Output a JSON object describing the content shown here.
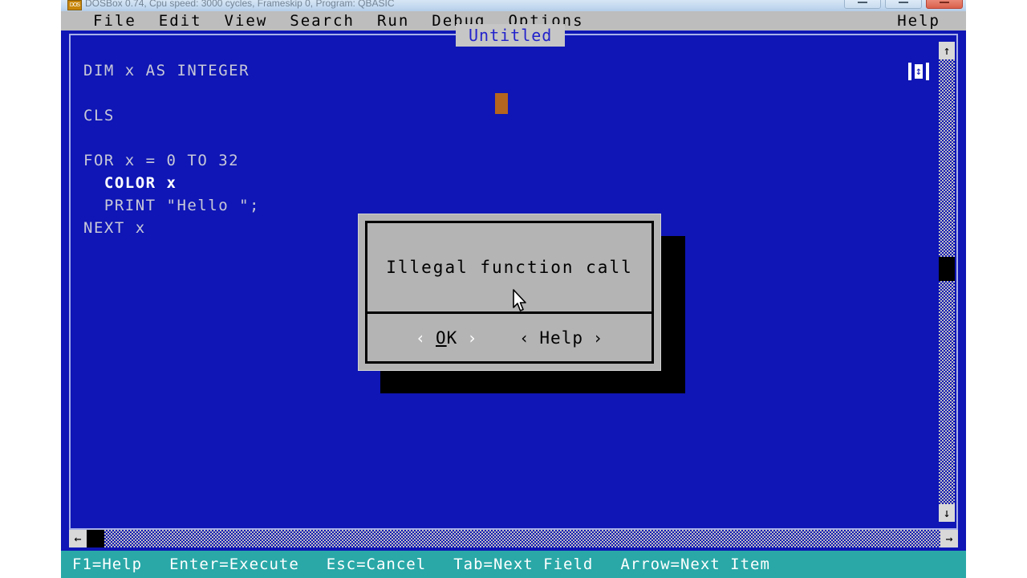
{
  "host_window": {
    "title": "DOSBox 0.74, Cpu speed: 3000 cycles, Frameskip 0, Program: QBASIC",
    "icon_label": "DOS",
    "buttons": [
      {
        "name": "minimize",
        "glyph": "_"
      },
      {
        "name": "maximize",
        "glyph": "□"
      },
      {
        "name": "close",
        "glyph": "×"
      }
    ]
  },
  "menubar": {
    "items": [
      {
        "label": "File"
      },
      {
        "label": "Edit"
      },
      {
        "label": "View"
      },
      {
        "label": "Search"
      },
      {
        "label": "Run"
      },
      {
        "label": "Debug"
      },
      {
        "label": "Options"
      }
    ],
    "help_label": "Help"
  },
  "editor": {
    "document_title": "Untitled",
    "code_lines": [
      {
        "text": "DIM x AS INTEGER",
        "highlight": false
      },
      {
        "text": "",
        "highlight": false
      },
      {
        "text": "CLS",
        "highlight": false
      },
      {
        "text": "",
        "highlight": false
      },
      {
        "text": "FOR x = 0 TO 32",
        "highlight": false
      },
      {
        "text": "  COLOR x",
        "highlight": true
      },
      {
        "text": "  PRINT \"Hello \";",
        "highlight": false
      },
      {
        "text": "NEXT x",
        "highlight": false
      }
    ],
    "vertical_scrollbar": {
      "up_arrow": "↑",
      "down_arrow": "↓"
    },
    "horizontal_scrollbar": {
      "left_arrow": "←",
      "right_arrow": "→"
    },
    "resize_grip": "↕"
  },
  "dialog": {
    "message": "Illegal function call",
    "buttons": [
      {
        "left_bracket": "‹",
        "right_bracket": "›",
        "accel": "O",
        "rest": "K",
        "selected": true
      },
      {
        "left_bracket": "‹",
        "right_bracket": "›",
        "accel": "",
        "rest": "Help",
        "selected": false
      }
    ]
  },
  "statusbar": {
    "items": [
      {
        "label": "F1=Help"
      },
      {
        "label": "Enter=Execute"
      },
      {
        "label": "Esc=Cancel"
      },
      {
        "label": "Tab=Next Field"
      },
      {
        "label": "Arrow=Next Item"
      }
    ]
  },
  "colors": {
    "editor_blue": "#0f16b5",
    "menubar_gray": "#bdbdbd",
    "status_teal": "#2aa8a8",
    "dialog_gray": "#b4b4b4",
    "caret_orange": "#b5651d",
    "title_text_blue": "#2222cc"
  }
}
